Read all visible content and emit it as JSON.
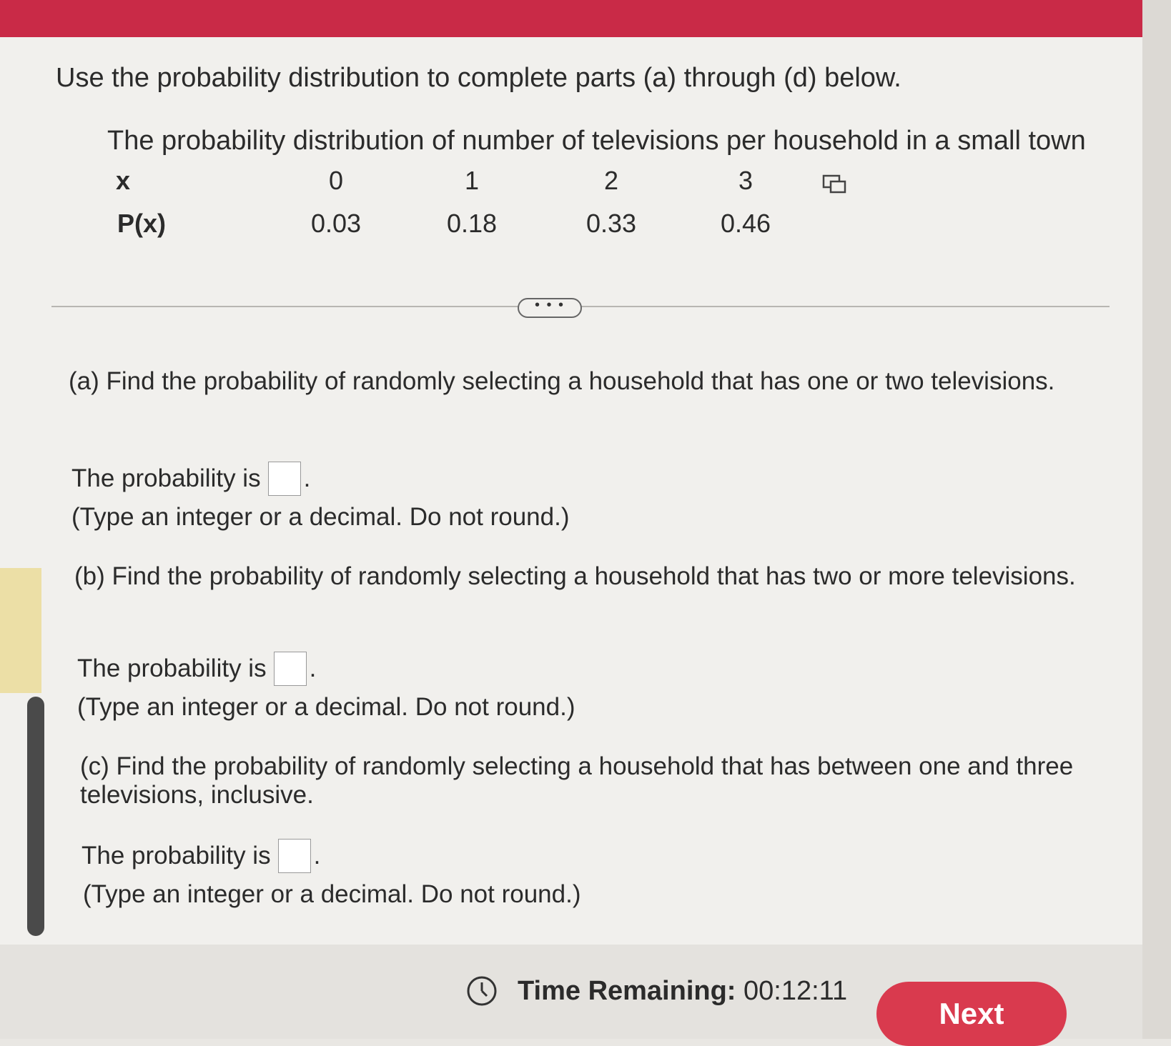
{
  "instruction": "Use the probability distribution to complete parts (a) through (d) below.",
  "table": {
    "caption": "The probability distribution of number of televisions per household in a small town",
    "x_label": "x",
    "p_label": "P(x)",
    "x_values": [
      "0",
      "1",
      "2",
      "3"
    ],
    "p_values": [
      "0.03",
      "0.18",
      "0.33",
      "0.46"
    ]
  },
  "more_button": "• • •",
  "parts": [
    {
      "question": "(a) Find the probability of randomly selecting a household that has one or two televisions.",
      "answer_prefix": "The probability is",
      "answer_value": "",
      "hint": "(Type an integer or a decimal. Do not round.)"
    },
    {
      "question": "(b) Find the probability of randomly selecting a household that has two or more televisions.",
      "answer_prefix": "The probability is",
      "answer_value": "",
      "hint": "(Type an integer or a decimal. Do not round.)"
    },
    {
      "question": "(c) Find the probability of randomly selecting a household that has between one and three televisions, inclusive.",
      "answer_prefix": "The probability is",
      "answer_value": "",
      "hint": "(Type an integer or a decimal. Do not round.)"
    }
  ],
  "footer": {
    "time_label": "Time Remaining:",
    "time_value": "00:12:11",
    "next_label": "Next"
  },
  "colors": {
    "header": "#c92a47",
    "next_button": "#d93a4e"
  }
}
